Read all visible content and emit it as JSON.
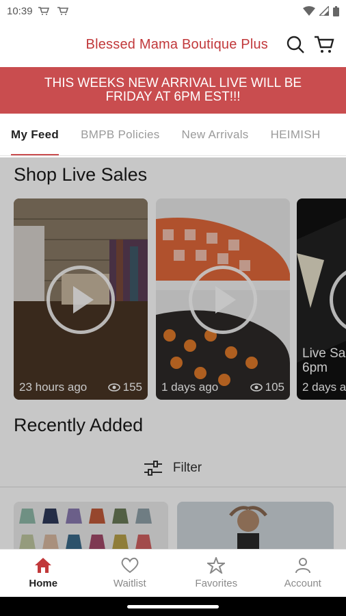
{
  "status_bar": {
    "time": "10:39"
  },
  "header": {
    "title": "Blessed Mama Boutique Plus"
  },
  "banner": {
    "text": "THIS WEEKS NEW ARRIVAL LIVE WILL BE FRIDAY AT 6PM EST!!!"
  },
  "tabs": [
    {
      "label": "My Feed",
      "active": true
    },
    {
      "label": "BMPB Policies",
      "active": false
    },
    {
      "label": "New Arrivals",
      "active": false
    },
    {
      "label": "HEIMISH",
      "active": false
    }
  ],
  "live_sales": {
    "title": "Shop Live Sales",
    "cards": [
      {
        "time": "23 hours ago",
        "views": "155"
      },
      {
        "time": "1 days ago",
        "views": "105"
      },
      {
        "overlay": "Live Sa\n6pm",
        "time": "2 days a"
      }
    ]
  },
  "recent": {
    "title": "Recently Added",
    "filter_label": "Filter"
  },
  "bottom_nav": [
    {
      "label": "Home",
      "icon": "home-icon",
      "active": true
    },
    {
      "label": "Waitlist",
      "icon": "heart-icon",
      "active": false
    },
    {
      "label": "Favorites",
      "icon": "star-icon",
      "active": false
    },
    {
      "label": "Account",
      "icon": "person-icon",
      "active": false
    }
  ],
  "colors": {
    "brand": "#c1383a",
    "banner": "#c94d4f"
  }
}
